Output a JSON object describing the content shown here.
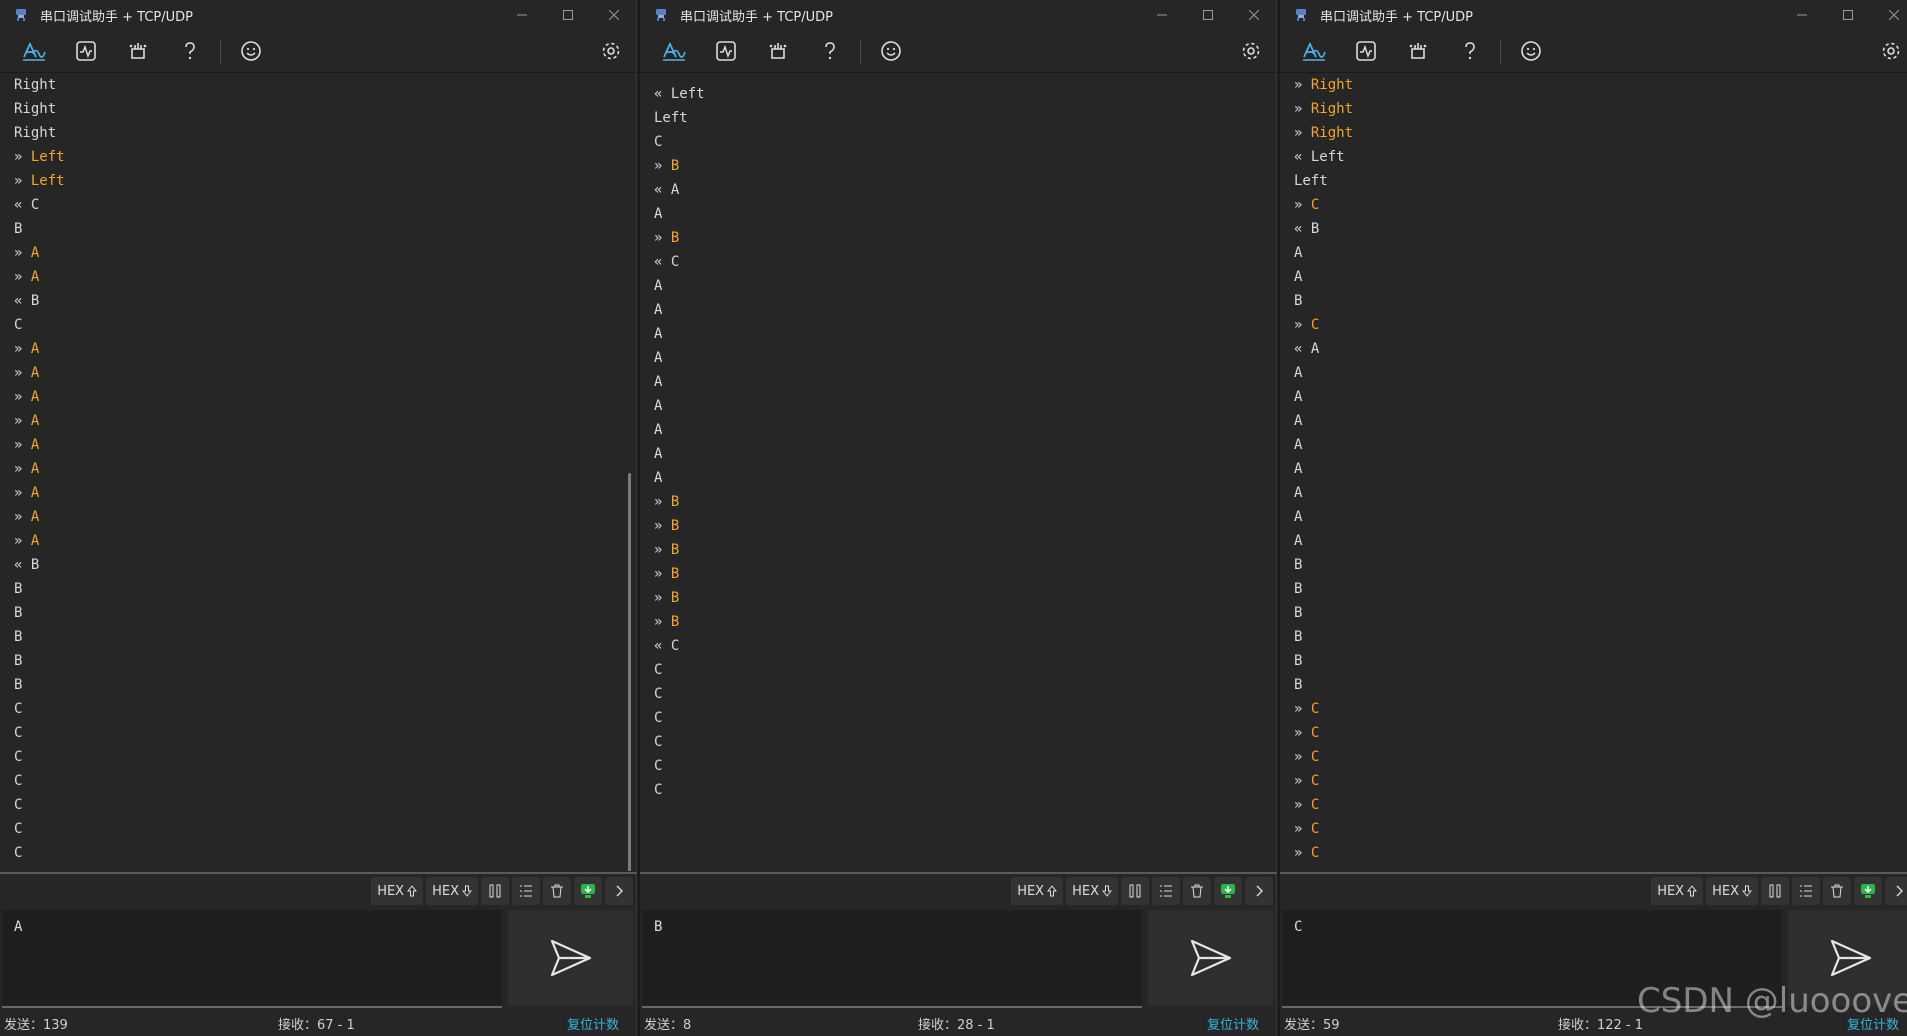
{
  "windows": [
    {
      "title": "串口调试助手 + TCP/UDP",
      "input_text": "A",
      "status": {
        "send": "发送：139",
        "recv": "接收：67 - 1",
        "reset": "复位计数"
      },
      "lines": [
        {
          "p": "",
          "t": "Right",
          "s": false
        },
        {
          "p": "",
          "t": "Right",
          "s": false
        },
        {
          "p": "",
          "t": "Right",
          "s": false
        },
        {
          "p": "» ",
          "t": "Left",
          "s": true
        },
        {
          "p": "» ",
          "t": "Left",
          "s": true
        },
        {
          "p": "« ",
          "t": "C",
          "s": false
        },
        {
          "p": "",
          "t": "B",
          "s": false
        },
        {
          "p": "» ",
          "t": "A",
          "s": true
        },
        {
          "p": "» ",
          "t": "A",
          "s": true
        },
        {
          "p": "« ",
          "t": "B",
          "s": false
        },
        {
          "p": "",
          "t": "C",
          "s": false
        },
        {
          "p": "» ",
          "t": "A",
          "s": true
        },
        {
          "p": "» ",
          "t": "A",
          "s": true
        },
        {
          "p": "» ",
          "t": "A",
          "s": true
        },
        {
          "p": "» ",
          "t": "A",
          "s": true
        },
        {
          "p": "» ",
          "t": "A",
          "s": true
        },
        {
          "p": "» ",
          "t": "A",
          "s": true
        },
        {
          "p": "» ",
          "t": "A",
          "s": true
        },
        {
          "p": "» ",
          "t": "A",
          "s": true
        },
        {
          "p": "» ",
          "t": "A",
          "s": true
        },
        {
          "p": "« ",
          "t": "B",
          "s": false
        },
        {
          "p": "",
          "t": "B",
          "s": false
        },
        {
          "p": "",
          "t": "B",
          "s": false
        },
        {
          "p": "",
          "t": "B",
          "s": false
        },
        {
          "p": "",
          "t": "B",
          "s": false
        },
        {
          "p": "",
          "t": "B",
          "s": false
        },
        {
          "p": "",
          "t": "C",
          "s": false
        },
        {
          "p": "",
          "t": "C",
          "s": false
        },
        {
          "p": "",
          "t": "C",
          "s": false
        },
        {
          "p": "",
          "t": "C",
          "s": false
        },
        {
          "p": "",
          "t": "C",
          "s": false
        },
        {
          "p": "",
          "t": "C",
          "s": false
        },
        {
          "p": "",
          "t": "C",
          "s": false
        }
      ]
    },
    {
      "title": "串口调试助手 + TCP/UDP",
      "input_text": "B",
      "status": {
        "send": "发送：8",
        "recv": "接收：28 - 1",
        "reset": "复位计数"
      },
      "lines": [
        {
          "p": "« ",
          "t": "Left",
          "s": false
        },
        {
          "p": "",
          "t": "Left",
          "s": false
        },
        {
          "p": "",
          "t": "C",
          "s": false
        },
        {
          "p": "» ",
          "t": "B",
          "s": true
        },
        {
          "p": "« ",
          "t": "A",
          "s": false
        },
        {
          "p": "",
          "t": "A",
          "s": false
        },
        {
          "p": "» ",
          "t": "B",
          "s": true
        },
        {
          "p": "« ",
          "t": "C",
          "s": false
        },
        {
          "p": "",
          "t": "A",
          "s": false
        },
        {
          "p": "",
          "t": "A",
          "s": false
        },
        {
          "p": "",
          "t": "A",
          "s": false
        },
        {
          "p": "",
          "t": "A",
          "s": false
        },
        {
          "p": "",
          "t": "A",
          "s": false
        },
        {
          "p": "",
          "t": "A",
          "s": false
        },
        {
          "p": "",
          "t": "A",
          "s": false
        },
        {
          "p": "",
          "t": "A",
          "s": false
        },
        {
          "p": "",
          "t": "A",
          "s": false
        },
        {
          "p": "» ",
          "t": "B",
          "s": true
        },
        {
          "p": "» ",
          "t": "B",
          "s": true
        },
        {
          "p": "» ",
          "t": "B",
          "s": true
        },
        {
          "p": "» ",
          "t": "B",
          "s": true
        },
        {
          "p": "» ",
          "t": "B",
          "s": true
        },
        {
          "p": "» ",
          "t": "B",
          "s": true
        },
        {
          "p": "« ",
          "t": "C",
          "s": false
        },
        {
          "p": "",
          "t": "C",
          "s": false
        },
        {
          "p": "",
          "t": "C",
          "s": false
        },
        {
          "p": "",
          "t": "C",
          "s": false
        },
        {
          "p": "",
          "t": "C",
          "s": false
        },
        {
          "p": "",
          "t": "C",
          "s": false
        },
        {
          "p": "",
          "t": "C",
          "s": false
        }
      ]
    },
    {
      "title": "串口调试助手 + TCP/UDP",
      "input_text": "C",
      "status": {
        "send": "发送：59",
        "recv": "接收：122 - 1",
        "reset": "复位计数"
      },
      "lines": [
        {
          "p": "» ",
          "t": "Right",
          "s": true
        },
        {
          "p": "» ",
          "t": "Right",
          "s": true
        },
        {
          "p": "» ",
          "t": "Right",
          "s": true
        },
        {
          "p": "« ",
          "t": "Left",
          "s": false
        },
        {
          "p": "",
          "t": "Left",
          "s": false
        },
        {
          "p": "» ",
          "t": "C",
          "s": true
        },
        {
          "p": "« ",
          "t": "B",
          "s": false
        },
        {
          "p": "",
          "t": "A",
          "s": false
        },
        {
          "p": "",
          "t": "A",
          "s": false
        },
        {
          "p": "",
          "t": "B",
          "s": false
        },
        {
          "p": "» ",
          "t": "C",
          "s": true
        },
        {
          "p": "« ",
          "t": "A",
          "s": false
        },
        {
          "p": "",
          "t": "A",
          "s": false
        },
        {
          "p": "",
          "t": "A",
          "s": false
        },
        {
          "p": "",
          "t": "A",
          "s": false
        },
        {
          "p": "",
          "t": "A",
          "s": false
        },
        {
          "p": "",
          "t": "A",
          "s": false
        },
        {
          "p": "",
          "t": "A",
          "s": false
        },
        {
          "p": "",
          "t": "A",
          "s": false
        },
        {
          "p": "",
          "t": "A",
          "s": false
        },
        {
          "p": "",
          "t": "B",
          "s": false
        },
        {
          "p": "",
          "t": "B",
          "s": false
        },
        {
          "p": "",
          "t": "B",
          "s": false
        },
        {
          "p": "",
          "t": "B",
          "s": false
        },
        {
          "p": "",
          "t": "B",
          "s": false
        },
        {
          "p": "",
          "t": "B",
          "s": false
        },
        {
          "p": "» ",
          "t": "C",
          "s": true
        },
        {
          "p": "» ",
          "t": "C",
          "s": true
        },
        {
          "p": "» ",
          "t": "C",
          "s": true
        },
        {
          "p": "» ",
          "t": "C",
          "s": true
        },
        {
          "p": "» ",
          "t": "C",
          "s": true
        },
        {
          "p": "» ",
          "t": "C",
          "s": true
        },
        {
          "p": "» ",
          "t": "C",
          "s": true
        }
      ]
    }
  ],
  "toolbar_icons": [
    "waveform-icon",
    "activity-monitor-icon",
    "plugin-icon",
    "help-icon",
    "smiley-icon",
    "gear-icon"
  ],
  "option_labels": {
    "hex_send": "HEX",
    "hex_recv": "HEX"
  },
  "option_icons": [
    "pause-icon",
    "list-icon",
    "trash-icon",
    "download-icon",
    "chevron-right-icon"
  ],
  "colors": {
    "sent_text": "#f5a623",
    "accent": "#33b4e0",
    "background": "#262626"
  },
  "watermark": "CSDN @luooove"
}
